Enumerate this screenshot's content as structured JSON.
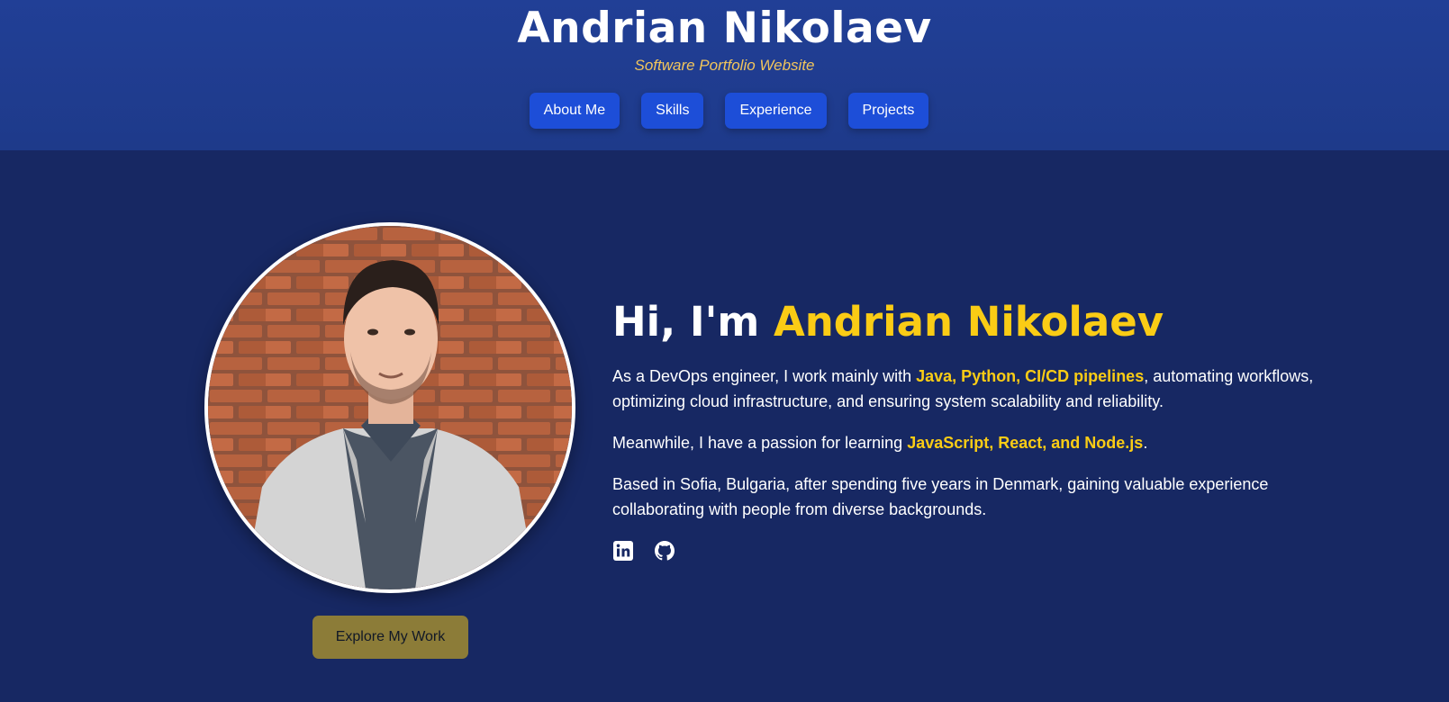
{
  "header": {
    "title": "Andrian Nikolaev",
    "subtitle": "Software Portfolio Website",
    "nav": [
      {
        "label": "About Me"
      },
      {
        "label": "Skills"
      },
      {
        "label": "Experience"
      },
      {
        "label": "Projects"
      }
    ]
  },
  "hero": {
    "greeting_prefix": "Hi, I'm ",
    "greeting_name": "Andrian Nikolaev",
    "p1": {
      "before": "As a DevOps engineer, I work mainly with ",
      "highlight": "Java, Python, CI/CD pipelines",
      "after": ", automating workflows, optimizing cloud infrastructure, and ensuring system scalability and reliability."
    },
    "p2": {
      "before": "Meanwhile, I have a passion for learning ",
      "highlight": "JavaScript, React, and Node.js",
      "after": "."
    },
    "p3": "Based in Sofia, Bulgaria, after spending five years in Denmark, gaining valuable experience collaborating with people from diverse backgrounds.",
    "explore_label": "Explore My Work",
    "socials": [
      {
        "icon": "linkedin-icon"
      },
      {
        "icon": "github-icon"
      }
    ]
  },
  "colors": {
    "header_bg": "#1e3a8a",
    "page_bg": "#172863",
    "accent": "#facc15",
    "subtitle": "#f2c55c",
    "nav_button": "#1d4ed8",
    "explore_button": "#8c7c38"
  }
}
